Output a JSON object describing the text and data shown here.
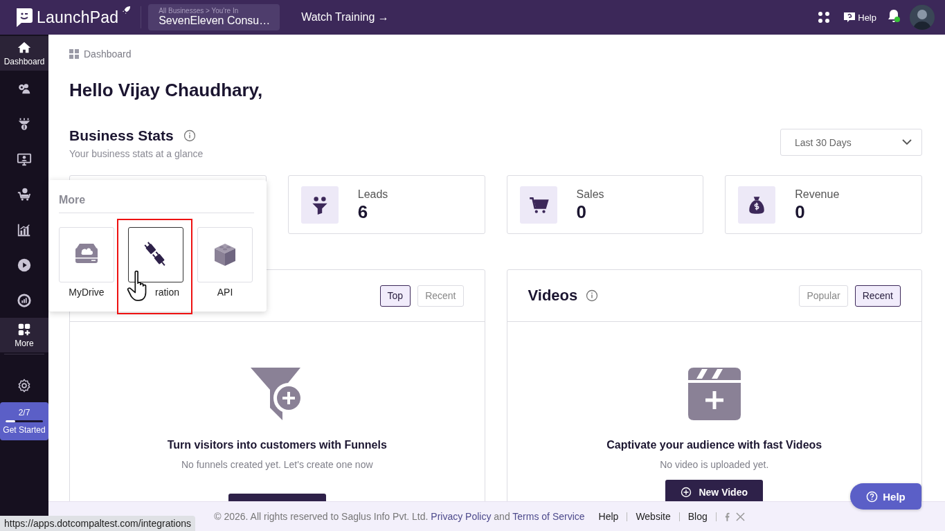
{
  "topbar": {
    "brand": "LaunchPad",
    "business_caption": "All Businesses > You're In",
    "business_name": "SevenEleven Consu…",
    "training_link": "Watch Training →",
    "help": "Help",
    "has_unread": true
  },
  "sidebar": {
    "items": [
      {
        "label": "Dashboard",
        "selected": true
      },
      {
        "selected": false
      },
      {
        "selected": false
      },
      {
        "selected": false
      },
      {
        "selected": false
      },
      {
        "selected": false
      },
      {
        "selected": false
      },
      {
        "selected": false
      },
      {
        "label": "More",
        "selected": true
      }
    ],
    "onboarding": {
      "progress": "2/7",
      "level": 0.25,
      "label": "Get Started"
    }
  },
  "breadcrumb": "Dashboard",
  "greeting": "Hello Vijay Chaudhary,",
  "business_stats": {
    "title": "Business Stats",
    "subtitle": "Your business stats at a glance",
    "period": "Last 30 Days",
    "cards": [
      {
        "kind": "leads",
        "label": "Leads",
        "value": "6"
      },
      {
        "kind": "sales",
        "label": "Sales",
        "value": "0"
      },
      {
        "kind": "revenue",
        "label": "Revenue",
        "value": "0"
      }
    ]
  },
  "panels": [
    {
      "kind": "funnels",
      "toggles": [
        {
          "label": "Top",
          "selected": true
        },
        {
          "label": "Recent",
          "selected": false
        }
      ],
      "empty_title": "Turn visitors into customers with Funnels",
      "empty_text": "No funnels created yet. Let's create one now"
    },
    {
      "kind": "videos",
      "title": "Videos",
      "toggles": [
        {
          "label": "Popular",
          "selected": false
        },
        {
          "label": "Recent",
          "selected": true
        }
      ],
      "empty_title": "Captivate your audience with fast Videos",
      "empty_text": "No video is uploaded yet.",
      "action": "New Video"
    }
  ],
  "more_menu": {
    "title": "More",
    "items": [
      {
        "kind": "drive",
        "label": "MyDrive",
        "hovered": false
      },
      {
        "kind": "plug",
        "label": "ration",
        "hovered": true
      },
      {
        "kind": "blocks",
        "label": "API",
        "hovered": false
      }
    ]
  },
  "footer": {
    "copyright": "©  2026. All rights reserved to Saglus Info Pvt. Ltd.",
    "privacy": "Privacy Policy",
    "joiner": "and",
    "terms": "Terms of Service",
    "links": [
      "Help",
      "Website",
      "Blog"
    ]
  },
  "help_button": "Help",
  "status_url": "https://apps.dotcompaltest.com/integrations"
}
